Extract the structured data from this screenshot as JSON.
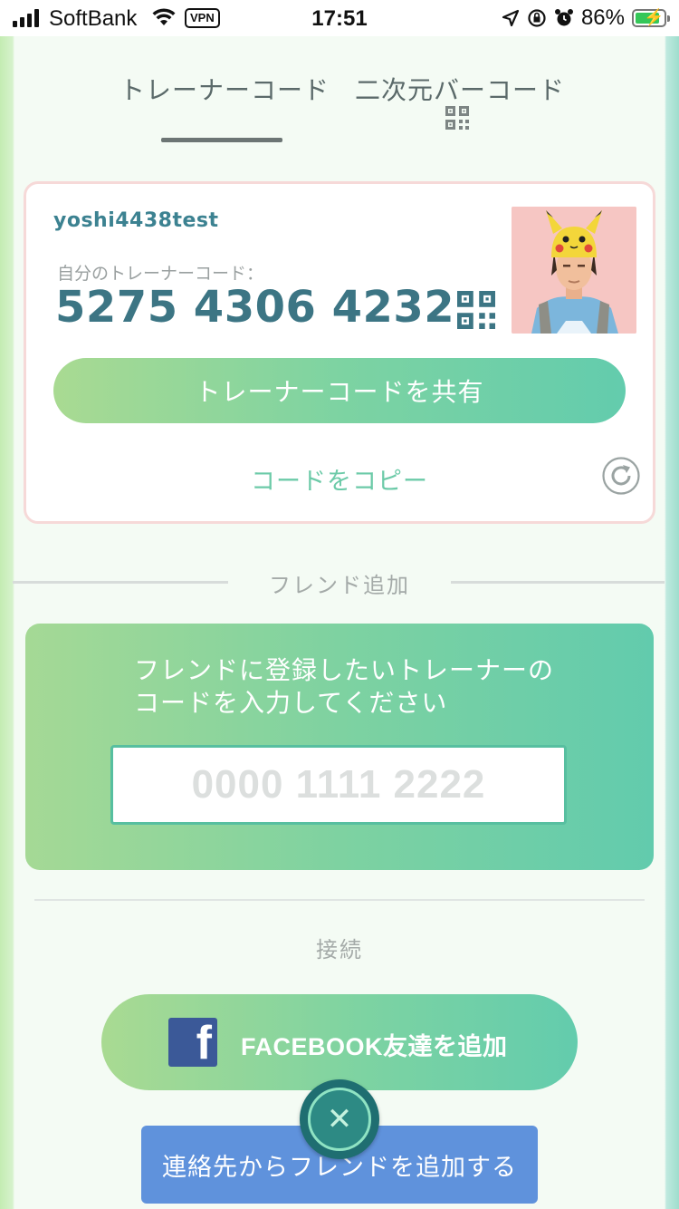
{
  "status_bar": {
    "carrier": "SoftBank",
    "vpn": "VPN",
    "time": "17:51",
    "battery": "86%"
  },
  "tabs": [
    {
      "label": "トレーナーコード",
      "active": true
    },
    {
      "label": "二次元バーコード",
      "active": false
    }
  ],
  "trainer": {
    "username": "yoshi4438test",
    "code_label": "自分のトレーナーコード：",
    "code": "5275 4306 4232",
    "share_button": "トレーナーコードを共有",
    "copy_link": "コードをコピー"
  },
  "friend_add": {
    "title": "フレンド追加",
    "instruction": "フレンドに登録したいトレーナーのコードを入力してください",
    "input_placeholder": "0000 1111 2222"
  },
  "connect": {
    "title": "接続",
    "facebook_button": "FACEBOOK友達を追加",
    "contacts_button": "連絡先からフレンドを追加する"
  },
  "colors": {
    "accent_gradient_start": "#a9da92",
    "accent_gradient_end": "#63ccad",
    "code_text": "#3c7584",
    "contacts_button": "#5f92dc",
    "facebook_blue": "#3b5998"
  }
}
